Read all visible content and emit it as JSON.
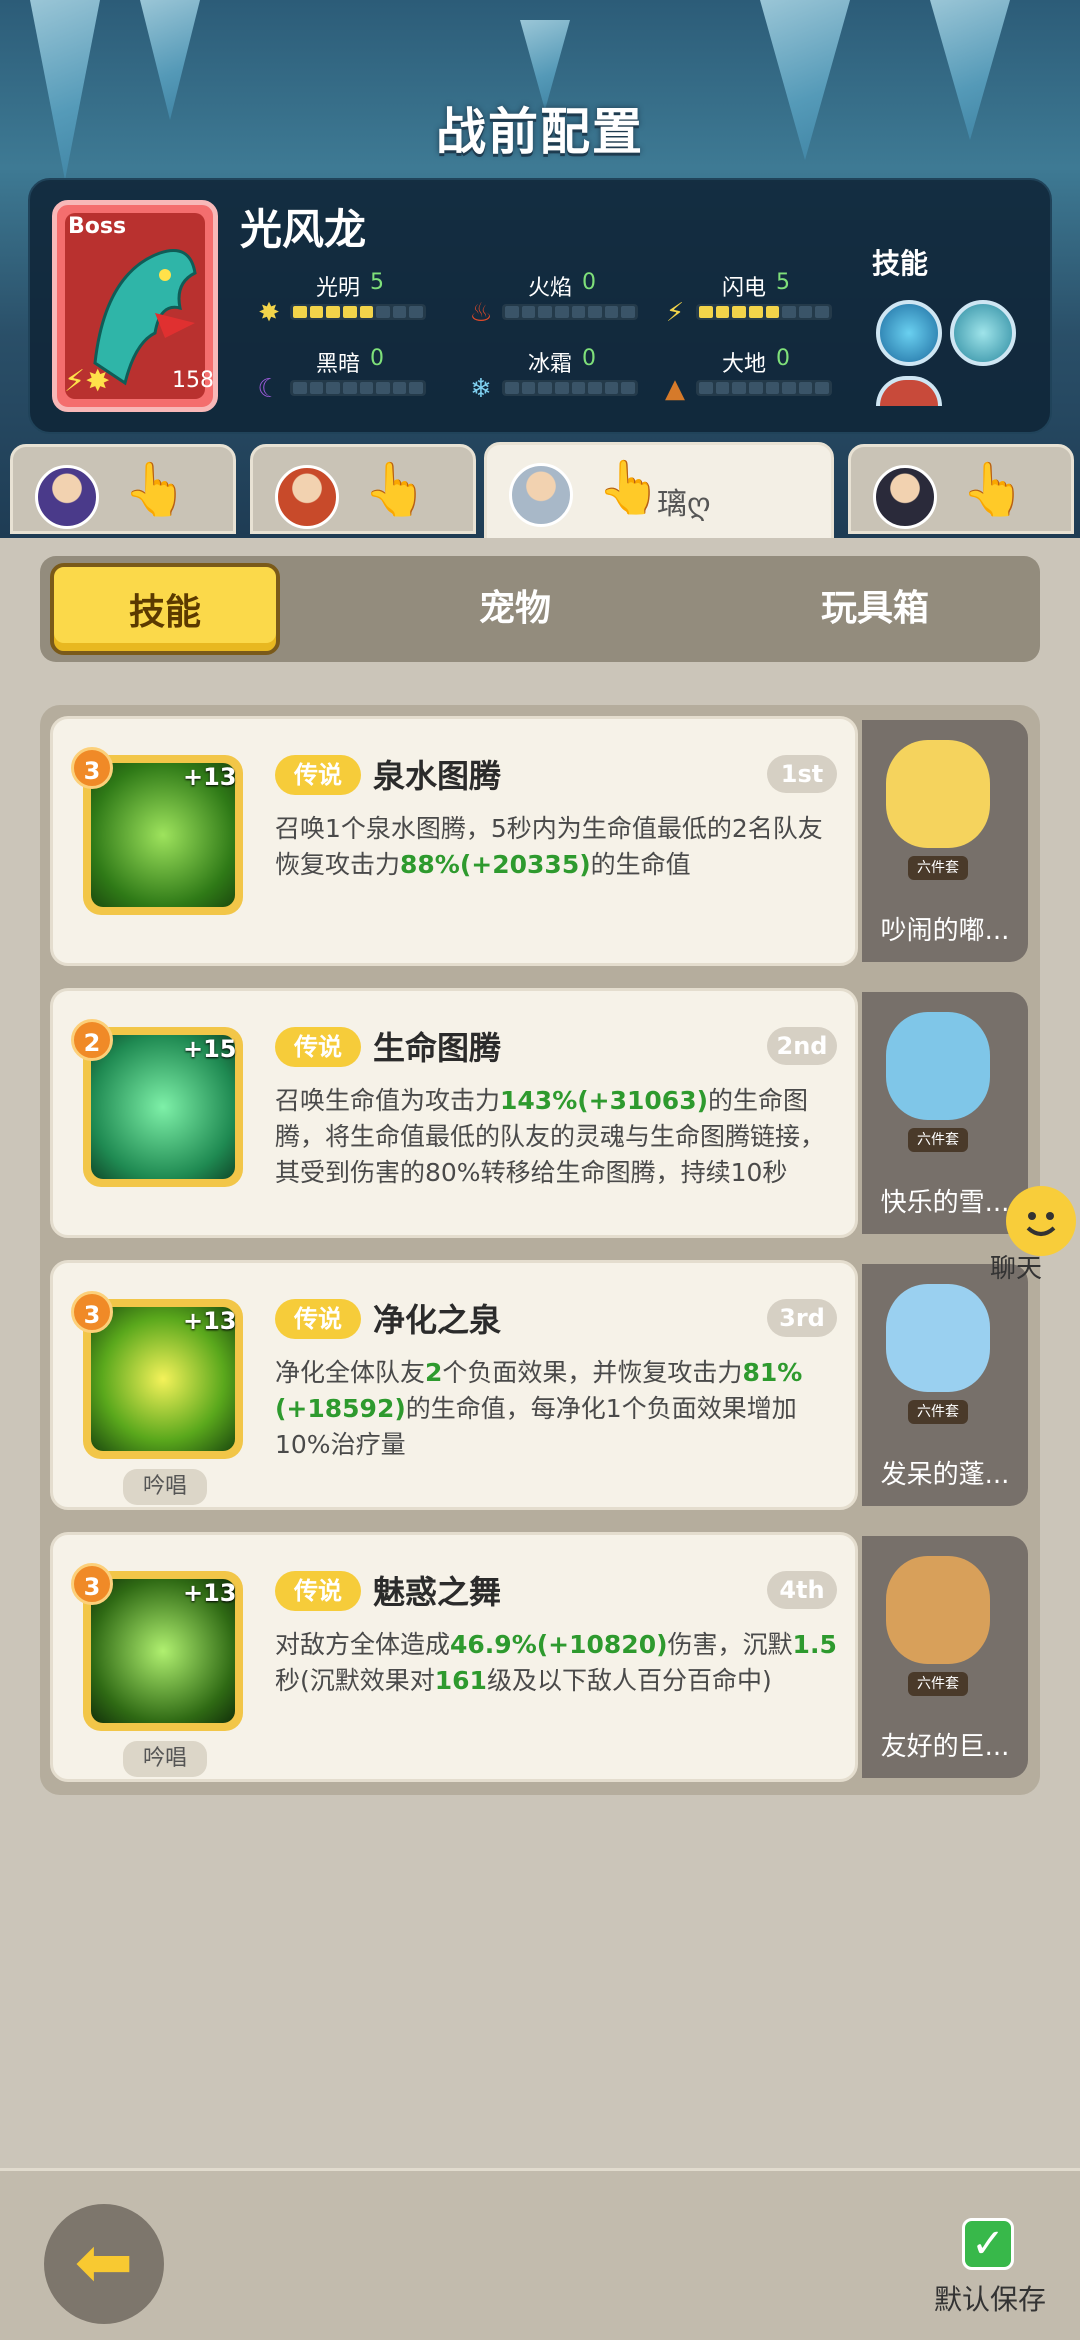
{
  "header": {
    "title": "战前配置"
  },
  "boss": {
    "badge": "Boss",
    "name": "光风龙",
    "level": "158",
    "elements": [
      {
        "label": "光明",
        "value": "5",
        "filled": 5,
        "icon": "sun-icon",
        "color": "#f3d44a"
      },
      {
        "label": "火焰",
        "value": "0",
        "filled": 0,
        "icon": "flame-icon",
        "color": "#e04a2a"
      },
      {
        "label": "闪电",
        "value": "5",
        "filled": 5,
        "icon": "lightning-icon",
        "color": "#f3d44a"
      },
      {
        "label": "黑暗",
        "value": "0",
        "filled": 0,
        "icon": "moon-icon",
        "color": "#9a5ad8"
      },
      {
        "label": "冰霜",
        "value": "0",
        "filled": 0,
        "icon": "snowflake-icon",
        "color": "#7fd0f0"
      },
      {
        "label": "大地",
        "value": "0",
        "filled": 0,
        "icon": "earth-icon",
        "color": "#d67a2a"
      }
    ],
    "skills_label": "技能"
  },
  "hero_tabs": [
    {
      "name": "",
      "selected": false
    },
    {
      "name": "",
      "selected": false
    },
    {
      "name": "璃ღ",
      "selected": true
    },
    {
      "name": "",
      "selected": false
    }
  ],
  "tabs": [
    "技能",
    "宠物",
    "玩具箱"
  ],
  "selected_tab": 0,
  "skills": [
    {
      "level": "3",
      "plus": "+13",
      "badge": "传说",
      "name": "泉水图腾",
      "rank": "1st",
      "desc": [
        [
          "召唤1个泉水图腾，5秒内为生命值最低的2名队友恢复攻击力",
          ""
        ],
        [
          "88%",
          "g"
        ],
        [
          "(+20335)",
          "g"
        ],
        [
          "的生命值",
          ""
        ]
      ],
      "chant": "",
      "pet": {
        "tag": "六件套",
        "name": "吵闹的嘟..."
      }
    },
    {
      "level": "2",
      "plus": "+15",
      "badge": "传说",
      "name": "生命图腾",
      "rank": "2nd",
      "desc": [
        [
          "召唤生命值为攻击力",
          ""
        ],
        [
          "143%",
          "g"
        ],
        [
          "(+31063)",
          "g"
        ],
        [
          "的生命图腾，将生命值最低的队友的灵魂与生命图腾链接，其受到伤害的80%转移给生命图腾，持续10秒",
          ""
        ]
      ],
      "chant": "",
      "pet": {
        "tag": "六件套",
        "name": "快乐的雪..."
      }
    },
    {
      "level": "3",
      "plus": "+13",
      "badge": "传说",
      "name": "净化之泉",
      "rank": "3rd",
      "desc": [
        [
          "净化全体队友",
          ""
        ],
        [
          "2",
          "g"
        ],
        [
          "个负面效果，并恢复攻击力",
          ""
        ],
        [
          "81%",
          "g"
        ],
        [
          "(+18592)",
          "g"
        ],
        [
          "的生命值，每净化1个负面效果增加10%治疗量",
          ""
        ]
      ],
      "chant": "吟唱",
      "pet": {
        "tag": "六件套",
        "name": "发呆的蓬..."
      }
    },
    {
      "level": "3",
      "plus": "+13",
      "badge": "传说",
      "name": "魅惑之舞",
      "rank": "4th",
      "desc": [
        [
          "对敌方全体造成",
          ""
        ],
        [
          "46.9%",
          "g"
        ],
        [
          "(+10820)",
          "g"
        ],
        [
          "伤害，沉默",
          ""
        ],
        [
          "1.5",
          "g"
        ],
        [
          "秒(沉默效果对",
          ""
        ],
        [
          "161",
          "g"
        ],
        [
          "级及以下敌人百分百命中)",
          ""
        ]
      ],
      "chant": "吟唱",
      "pet": {
        "tag": "六件套",
        "name": "友好的巨..."
      }
    }
  ],
  "chat": {
    "label": "聊天"
  },
  "footer": {
    "save_label": "默认保存"
  }
}
